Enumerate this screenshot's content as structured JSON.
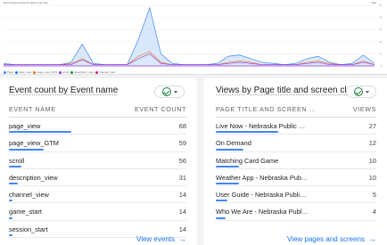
{
  "overview": {
    "title": "Event count by Event name over time",
    "dropdown": "Day",
    "legend": [
      {
        "label": "Page",
        "color": "#4285f4"
      },
      {
        "label": "page_view",
        "color": "#1a73e8"
      },
      {
        "label": "page_view_GTM",
        "color": "#e8710a"
      },
      {
        "label": "scroll",
        "color": "#9334e6"
      },
      {
        "label": "description_view",
        "color": "#1e8e3e"
      },
      {
        "label": "channel_view",
        "color": "#d01884"
      }
    ]
  },
  "chart_data": {
    "type": "area",
    "series": [
      {
        "name": "page_view",
        "values": [
          2,
          1,
          1,
          1,
          1,
          1,
          3,
          18,
          2,
          1,
          1,
          1,
          22,
          48,
          10,
          2,
          1,
          1,
          1,
          2,
          8,
          9,
          6,
          3,
          2,
          1,
          2,
          6,
          8,
          3,
          1,
          2,
          9,
          2
        ]
      },
      {
        "name": "page_view_GTM",
        "values": [
          1,
          1,
          1,
          1,
          1,
          1,
          2,
          6,
          1,
          1,
          1,
          1,
          8,
          12,
          3,
          1,
          1,
          1,
          1,
          1,
          3,
          4,
          3,
          1,
          1,
          1,
          1,
          3,
          4,
          2,
          1,
          1,
          4,
          1
        ]
      },
      {
        "name": "scroll",
        "values": [
          1,
          1,
          1,
          1,
          1,
          1,
          1,
          5,
          1,
          1,
          1,
          1,
          6,
          10,
          2,
          1,
          1,
          1,
          1,
          1,
          2,
          3,
          2,
          1,
          1,
          1,
          1,
          2,
          3,
          1,
          1,
          1,
          3,
          1
        ]
      }
    ],
    "colors": [
      "#4285f4",
      "#e8710a",
      "#9334e6"
    ],
    "fill": "#cfe2fb"
  },
  "event_card": {
    "title": "Event count by Event name",
    "col_name": "EVENT NAME",
    "col_value": "EVENT COUNT",
    "rows": [
      {
        "label": "page_view",
        "value": "68",
        "fraction": 1.0
      },
      {
        "label": "page_view_GTM",
        "value": "59",
        "fraction": 0.55
      },
      {
        "label": "scroll",
        "value": "56",
        "fraction": 0.2
      },
      {
        "label": "description_view",
        "value": "31",
        "fraction": 0.14
      },
      {
        "label": "channel_view",
        "value": "14",
        "fraction": 0.06
      },
      {
        "label": "game_start",
        "value": "14",
        "fraction": 0.06
      },
      {
        "label": "session_start",
        "value": "14",
        "fraction": 0.06
      }
    ],
    "link": "View events"
  },
  "page_card": {
    "title": "Views by Page title and screen class",
    "col_name": "PAGE TITLE AND SCREEN …",
    "col_value": "VIEWS",
    "rows": [
      {
        "label": "Live Now - Nebraska Public …",
        "value": "27",
        "fraction": 1.0
      },
      {
        "label": "On Demand",
        "value": "12",
        "fraction": 0.44
      },
      {
        "label": "Matching Card Game",
        "value": "10",
        "fraction": 0.37
      },
      {
        "label": "Weather App - Nebraska Pub…",
        "value": "10",
        "fraction": 0.37
      },
      {
        "label": "User Guide - Nebraska Publi…",
        "value": "5",
        "fraction": 0.19
      },
      {
        "label": "Who We Are - Nebraska Publ…",
        "value": "4",
        "fraction": 0.15
      }
    ],
    "link": "View pages and screens"
  }
}
